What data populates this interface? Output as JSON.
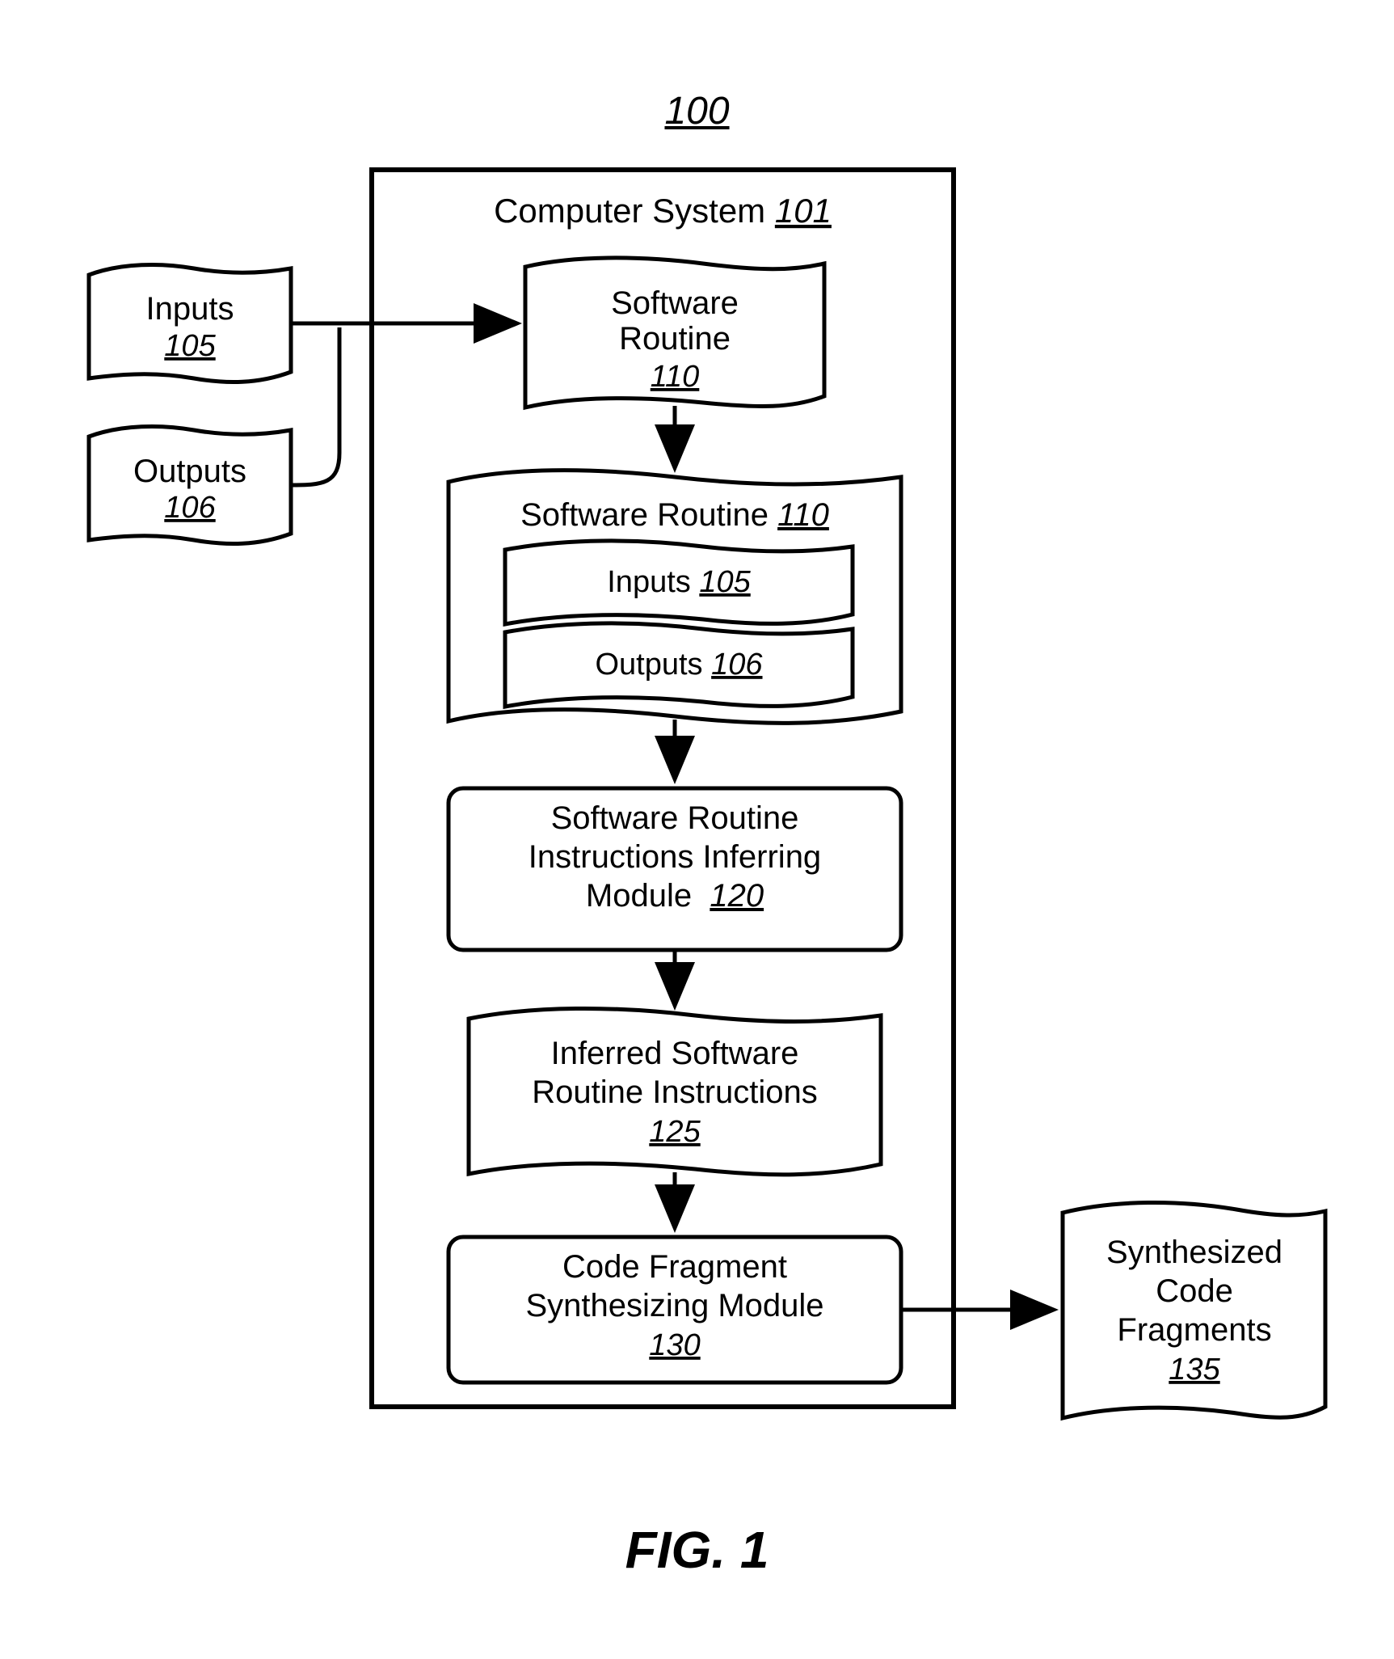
{
  "figure": {
    "label": "FIG. 1",
    "ref100": "100"
  },
  "system": {
    "title": "Computer System",
    "num": "101"
  },
  "inputs": {
    "title": "Inputs",
    "num": "105"
  },
  "outputs": {
    "title": "Outputs",
    "num": "106"
  },
  "routine": {
    "title_l1": "Software",
    "title_l2": "Routine",
    "num": "110"
  },
  "routine_inner": {
    "title": "Software Routine",
    "num": "110"
  },
  "routine_inner_inputs": {
    "title": "Inputs",
    "num": "105"
  },
  "routine_inner_outputs": {
    "title": "Outputs",
    "num": "106"
  },
  "inferring": {
    "l1": "Software Routine",
    "l2": "Instructions Inferring",
    "l3": "Module",
    "num": "120"
  },
  "inferred": {
    "l1": "Inferred Software",
    "l2": "Routine Instructions",
    "num": "125"
  },
  "synth_module": {
    "l1": "Code Fragment",
    "l2": "Synthesizing Module",
    "num": "130"
  },
  "synth_out": {
    "l1": "Synthesized",
    "l2": "Code",
    "l3": "Fragments",
    "num": "135"
  }
}
